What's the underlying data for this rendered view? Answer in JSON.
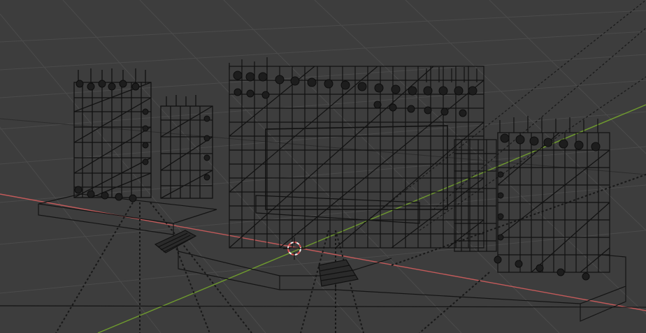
{
  "viewport": {
    "mode": "wireframe",
    "background_color": "#3d3d3d",
    "grid_color": "#4a4a4a",
    "x_axis_color": "#c25a5a",
    "y_axis_color": "#6f9b2e",
    "wire_color": "#111111",
    "cursor_color": "#e04f4f"
  },
  "scene": {
    "objects": [
      {
        "name": "left-scaffold-tower"
      },
      {
        "name": "left-small-scaffold"
      },
      {
        "name": "main-stage-scaffold"
      },
      {
        "name": "right-scaffold-tower"
      },
      {
        "name": "stage-platform"
      },
      {
        "name": "front-stairs"
      },
      {
        "name": "side-stairs"
      }
    ]
  },
  "cursor": {
    "name": "3d-cursor-icon"
  }
}
